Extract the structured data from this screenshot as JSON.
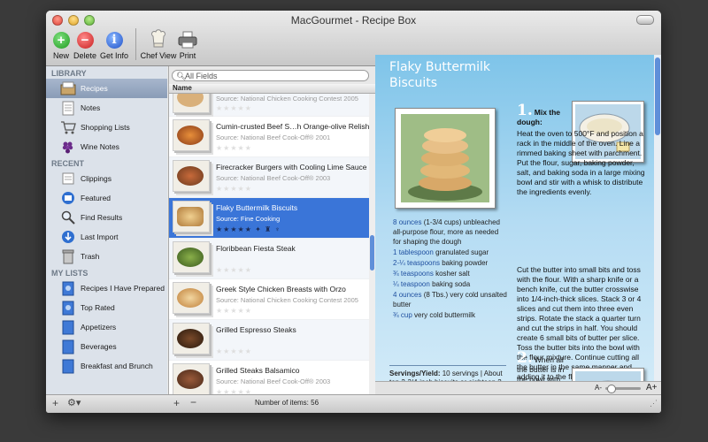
{
  "window": {
    "title": "MacGourmet - Recipe Box"
  },
  "toolbar": {
    "new_label": "New",
    "delete_label": "Delete",
    "getinfo_label": "Get Info",
    "chefview_label": "Chef View",
    "print_label": "Print"
  },
  "sidebar": {
    "library_header": "LIBRARY",
    "library": [
      {
        "label": "Recipes",
        "icon": "recipe-box-icon"
      },
      {
        "label": "Notes",
        "icon": "notes-icon"
      },
      {
        "label": "Shopping Lists",
        "icon": "shopping-cart-icon"
      },
      {
        "label": "Wine Notes",
        "icon": "grapes-icon"
      }
    ],
    "recent_header": "RECENT",
    "recent": [
      {
        "label": "Clippings",
        "icon": "clipping-icon"
      },
      {
        "label": "Featured",
        "icon": "featured-icon"
      },
      {
        "label": "Find Results",
        "icon": "magnifier-icon"
      },
      {
        "label": "Last Import",
        "icon": "import-icon"
      },
      {
        "label": "Trash",
        "icon": "trash-icon"
      }
    ],
    "mylists_header": "MY LISTS",
    "mylists": [
      {
        "label": "Recipes I Have Prepared"
      },
      {
        "label": "Top Rated"
      },
      {
        "label": "Appetizers"
      },
      {
        "label": "Beverages"
      },
      {
        "label": "Breakfast and Brunch"
      }
    ]
  },
  "list": {
    "search_placeholder": "All Fields",
    "column_header": "Name",
    "rows": [
      {
        "title": "",
        "source": "Source: National Chicken Cooking Contest 2005",
        "stars": "★★★★★"
      },
      {
        "title": "Cumin-crusted Beef S…h Orange-olive Relish",
        "source": "Source: National Beef Cook-Off® 2001",
        "stars": "★★★★★"
      },
      {
        "title": "Firecracker Burgers with Cooling Lime Sauce",
        "source": "Source: National Beef Cook-Off® 2003",
        "stars": "★★★★★"
      },
      {
        "title": "Flaky Buttermilk Biscuits",
        "source": "Source: Fine Cooking",
        "stars": "★★★★★  ✦ ♜ ♆"
      },
      {
        "title": "Floribbean Fiesta Steak",
        "source": "",
        "stars": "★★★★★"
      },
      {
        "title": "Greek Style Chicken Breasts with Orzo",
        "source": "Source: National Chicken Cooking Contest 2005",
        "stars": "★★★★★"
      },
      {
        "title": "Grilled Espresso Steaks",
        "source": "",
        "stars": "★★★★★"
      },
      {
        "title": "Grilled Steaks Balsamico",
        "source": "Source: National Beef Cook-Off® 2003",
        "stars": "★★★★★"
      }
    ],
    "item_count": "Number of items: 56"
  },
  "recipe": {
    "title": "Flaky Buttermilk Biscuits",
    "ingredients": [
      {
        "qty": "8",
        "unit": "ounces",
        "text": "(1-3/4 cups) unbleached all-purpose flour, more as needed for shaping the dough"
      },
      {
        "qty": "1",
        "unit": "tablespoon",
        "text": "granulated sugar"
      },
      {
        "qty": "2-¼",
        "unit": "teaspoons",
        "text": "baking powder"
      },
      {
        "qty": "¾",
        "unit": "teaspoons",
        "text": "kosher salt"
      },
      {
        "qty": "¼",
        "unit": "teaspoon",
        "text": "baking soda"
      },
      {
        "qty": "4",
        "unit": "ounces",
        "text": "(8 Tbs.) very cold unsalted butter"
      },
      {
        "qty": "¾",
        "unit": "cup",
        "text": "very cold buttermilk"
      }
    ],
    "servings_label": "Servings/Yield:",
    "servings_text": "10 servings | About ten 2-3/4-inch biscuits or eighteen 2-inch biscuits",
    "step1_num": "1.",
    "step1_a": "Mix the dough:",
    "step1_b": "Heat the oven to 500°F and position a rack in the middle of the oven. Line a rimmed baking sheet with parchment. Put the flour, sugar, baking powder, salt, and baking soda in a large mixing bowl and stir with a whisk to distribute the ingredients evenly.",
    "step1_c": "Cut the butter into small bits and toss with the flour. With a sharp knife or a bench knife, cut the butter crosswise into 1/4-inch-thick slices. Stack 3 or 4 slices and cut them into three even strips. Rotate the stack a quarter turn and cut the strips in half. You should create 6 small bits of butter per slice. Toss the butter bits into the bowl with the flour mixture. Continue cutting all the butter in the same manner and adding it to the flour mixture.",
    "step2_num": "2.",
    "step2_text": "When all the butter is in the bowl with the flour, use",
    "zoom_small": "A-",
    "zoom_large": "A+"
  }
}
